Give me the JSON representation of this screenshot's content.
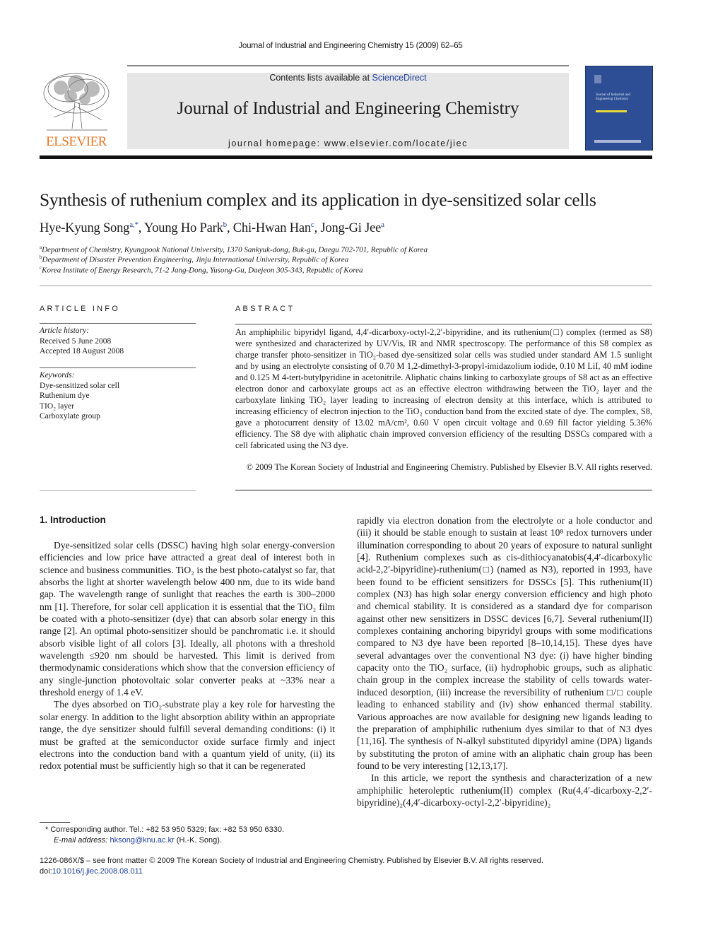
{
  "header": {
    "running_head": "Journal of Industrial and Engineering Chemistry 15 (2009) 62–65",
    "contents_prefix": "Contents lists available at ",
    "contents_link": "ScienceDirect",
    "journal_title": "Journal of Industrial and Engineering Chemistry",
    "homepage": "journal homepage: www.elsevier.com/locate/jiec",
    "publisher_logo": "ELSEVIER",
    "cover_title": "Journal of Industrial and Engineering Chemistry",
    "colors": {
      "publisher": "#e87722",
      "link": "#1f3f9c",
      "cover": "#2d4e94"
    }
  },
  "article": {
    "title": "Synthesis of ruthenium complex and its application in dye-sensitized solar cells",
    "authors": [
      {
        "name": "Hye-Kyung Song",
        "marks": "a,*"
      },
      {
        "name": "Young Ho Park",
        "marks": "b"
      },
      {
        "name": "Chi-Hwan Han",
        "marks": "c"
      },
      {
        "name": "Jong-Gi Jee",
        "marks": "a"
      }
    ],
    "affiliations": [
      {
        "mark": "a",
        "text": "Department of Chemistry, Kyungpook National University, 1370 Sankyuk-dong, Buk-gu, Daegu 702-701, Republic of Korea"
      },
      {
        "mark": "b",
        "text": "Department of Disaster Prevention Engineering, Jinju International University, Republic of Korea"
      },
      {
        "mark": "c",
        "text": "Korea Institute of Energy Research, 71-2 Jang-Dong, Yusong-Gu, Daejeon 305-343, Republic of Korea"
      }
    ]
  },
  "article_info": {
    "heading": "ARTICLE INFO",
    "history_label": "Article history:",
    "received": "Received 5 June 2008",
    "accepted": "Accepted 18 August 2008",
    "keywords_label": "Keywords:",
    "keywords": [
      "Dye-sensitized solar cell",
      "Ruthenium dye",
      "TIO₂ layer",
      "Carboxylate group"
    ]
  },
  "abstract": {
    "heading": "ABSTRACT",
    "text": "An amphiphilic bipyridyl ligand, 4,4′-dicarboxy-octyl-2,2′-bipyridine, and its ruthenium(□) complex (termed as S8) were synthesized and characterized by UV/Vis, IR and NMR spectroscopy. The performance of this S8 complex as charge transfer photo-sensitizer in TiO₂-based dye-sensitized solar cells was studied under standard AM 1.5 sunlight and by using an electrolyte consisting of 0.70 M 1,2-dimethyl-3-propyl-imidazolium iodide, 0.10 M LiI, 40 mM iodine and 0.125 M 4-tert-butylpyridine in acetonitrile. Aliphatic chains linking to carboxylate groups of S8 act as an effective electron donor and carboxylate groups act as an effective electron withdrawing between the TiO₂ layer and the carboxylate linking TiO₂ layer leading to increasing of electron density at this interface, which is attributed to increasing efficiency of electron injection to the TiO₂ conduction band from the excited state of dye. The complex, S8, gave a photocurrent density of 13.02 mA/cm², 0.60 V open circuit voltage and 0.69 fill factor yielding 5.36% efficiency. The S8 dye with aliphatic chain improved conversion efficiency of the resulting DSSCs compared with a cell fabricated using the N3 dye.",
    "copyright": "© 2009 The Korean Society of Industrial and Engineering Chemistry. Published by Elsevier B.V. All rights reserved."
  },
  "body": {
    "section_heading": "1.  Introduction",
    "left_col": [
      "Dye-sensitized solar cells (DSSC) having high solar energy-conversion efficiencies and low price have attracted a great deal of interest both in science and business communities. TiO₂ is the best photo-catalyst so far, that absorbs the light at shorter wavelength below 400 nm, due to its wide band gap. The wavelength range of sunlight that reaches the earth is 300–2000 nm [1]. Therefore, for solar cell application it is essential that the TiO₂ film be coated with a photo-sensitizer (dye) that can absorb solar energy in this range [2]. An optimal photo-sensitizer should be panchromatic i.e. it should absorb visible light of all colors [3]. Ideally, all photons with a threshold wavelength ≤920 nm should be harvested. This limit is derived from thermodynamic considerations which show that the conversion efficiency of any single-junction photovoltaic solar converter peaks at ~33% near a threshold energy of 1.4 eV.",
      "The dyes absorbed on TiO₂-substrate play a key role for harvesting the solar energy. In addition to the light absorption ability within an appropriate range, the dye sensitizer should fulfill several demanding conditions: (i) it must be grafted at the semiconductor oxide surface firmly and inject electrons into the conduction band with a quantum yield of unity, (ii) its redox potential must be sufficiently high so that it can be regenerated"
    ],
    "right_col": [
      "rapidly via electron donation from the electrolyte or a hole conductor and (iii) it should be stable enough to sustain at least 10⁸ redox turnovers under illumination corresponding to about 20 years of exposure to natural sunlight [4]. Ruthenium complexes such as cis-dithiocyanatobis(4,4′-dicarboxylic acid-2,2′-bipyridine)-ruthenium(□) (named as N3), reported in 1993, have been found to be efficient sensitizers for DSSCs [5]. This ruthenium(II) complex (N3) has high solar energy conversion efficiency and high photo and chemical stability. It is considered as a standard dye for comparison against other new sensitizers in DSSC devices [6,7]. Several ruthenium(II) complexes containing anchoring bipyridyl groups with some modifications compared to N3 dye have been reported [8–10,14,15]. These dyes have several advantages over the conventional N3 dye: (i) have higher binding capacity onto the TiO₂ surface, (ii) hydrophobic groups, such as aliphatic chain group in the complex increase the stability of cells towards water-induced desorption, (iii) increase the reversibility of ruthenium □/□ couple leading to enhanced stability and (iv) show enhanced thermal stability. Various approaches are now available for designing new ligands leading to the preparation of amphiphilic ruthenium dyes similar to that of N3 dyes [11,16]. The synthesis of N-alkyl substituted dipyridyl amine (DPA) ligands by substituting the proton of amine with an aliphatic chain group has been found to be very interesting [12,13,17].",
      "In this article, we report the synthesis and characterization of a new amphiphilic heteroleptic ruthenium(II) complex (Ru(4,4′-dicarboxy-2,2′-bipyridine)₂(4,4′-dicarboxy-octyl-2,2′-bipyridine)₂"
    ]
  },
  "footnote": {
    "corresponding": "* Corresponding author. Tel.: +82 53 950 5329; fax: +82 53 950 6330.",
    "email_label": "E-mail address: ",
    "email": "hksong@knu.ac.kr",
    "email_suffix": " (H.-K. Song)."
  },
  "footer": {
    "issn_line": "1226-086X/$ – see front matter © 2009 The Korean Society of Industrial and Engineering Chemistry. Published by Elsevier B.V. All rights reserved.",
    "doi_label": "doi:",
    "doi": "10.1016/j.jiec.2008.08.011"
  }
}
